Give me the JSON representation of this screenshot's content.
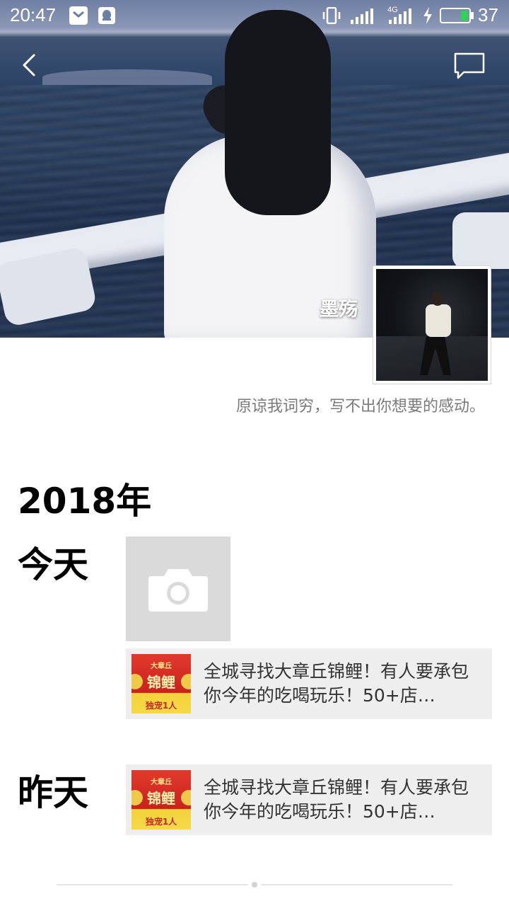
{
  "status_bar": {
    "time": "20:47",
    "battery_percent": "37",
    "network": "4G",
    "icons": [
      "notification-shield-icon",
      "qq-icon",
      "vibrate-icon",
      "wifi-signal-icon",
      "cellular-signal-icon",
      "charging-icon",
      "battery-icon"
    ]
  },
  "header": {
    "back_icon": "chevron-left-icon",
    "comment_icon": "message-bubble-icon"
  },
  "profile": {
    "username": "墨殇",
    "signature": "原谅我词穷，写不出你想要的感动。"
  },
  "timeline": {
    "year": "2018年",
    "days": [
      {
        "label": "今天",
        "has_photo_placeholder": true,
        "share": {
          "thumb_top": "大章丘",
          "thumb_main": "锦鲤",
          "thumb_bottom": "独宠1人",
          "text": "全城寻找大章丘锦鲤！有人要承包你今年的吃喝玩乐！50+店…"
        }
      },
      {
        "label": "昨天",
        "share": {
          "thumb_top": "大章丘",
          "thumb_main": "锦鲤",
          "thumb_bottom": "独宠1人",
          "text": "全城寻找大章丘锦鲤！有人要承包你今年的吃喝玩乐！50+店…"
        }
      }
    ]
  },
  "colors": {
    "signature_text": "#7a7a7a",
    "card_bg": "#eeeeee",
    "placeholder_bg": "#dadada",
    "battery_fill": "#31d158"
  }
}
